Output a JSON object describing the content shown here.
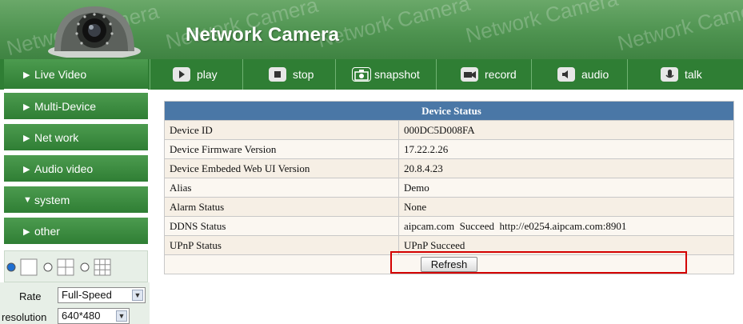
{
  "header": {
    "brand": "Network Camera",
    "watermark": "Network Camera"
  },
  "toolbar": [
    {
      "label": "play",
      "icon": "play-icon"
    },
    {
      "label": "stop",
      "icon": "stop-icon"
    },
    {
      "label": "snapshot",
      "icon": "camera-icon"
    },
    {
      "label": "record",
      "icon": "record-icon"
    },
    {
      "label": "audio",
      "icon": "speaker-icon"
    },
    {
      "label": "talk",
      "icon": "microphone-icon"
    }
  ],
  "sidebar": {
    "items": [
      {
        "label": "Live Video",
        "marker": "▶"
      },
      {
        "label": "Multi-Device",
        "marker": "▶"
      },
      {
        "label": "Net work",
        "marker": "▶"
      },
      {
        "label": "Audio video",
        "marker": "▶"
      },
      {
        "label": "system",
        "marker": "▼"
      },
      {
        "label": "other",
        "marker": "▶"
      }
    ],
    "rate_label": "Rate",
    "rate_value": "Full-Speed",
    "resolution_label": "resolution",
    "resolution_value": "640*480"
  },
  "device_status": {
    "title": "Device Status",
    "rows": [
      {
        "label": "Device ID",
        "value": "000DC5D008FA"
      },
      {
        "label": "Device Firmware Version",
        "value": "17.22.2.26"
      },
      {
        "label": "Device Embeded Web UI Version",
        "value": "20.8.4.23"
      },
      {
        "label": "Alias",
        "value": "Demo"
      },
      {
        "label": "Alarm Status",
        "value": "None"
      },
      {
        "label": "DDNS Status",
        "value": "aipcam.com  Succeed  http://e0254.aipcam.com:8901"
      },
      {
        "label": "UPnP Status",
        "value": "UPnP Succeed"
      }
    ],
    "refresh_label": "Refresh"
  },
  "colors": {
    "banner_green": "#4e9350",
    "toolbar_green": "#2f7e34",
    "table_header_blue": "#4a77a6",
    "highlight_red": "#d30000"
  }
}
